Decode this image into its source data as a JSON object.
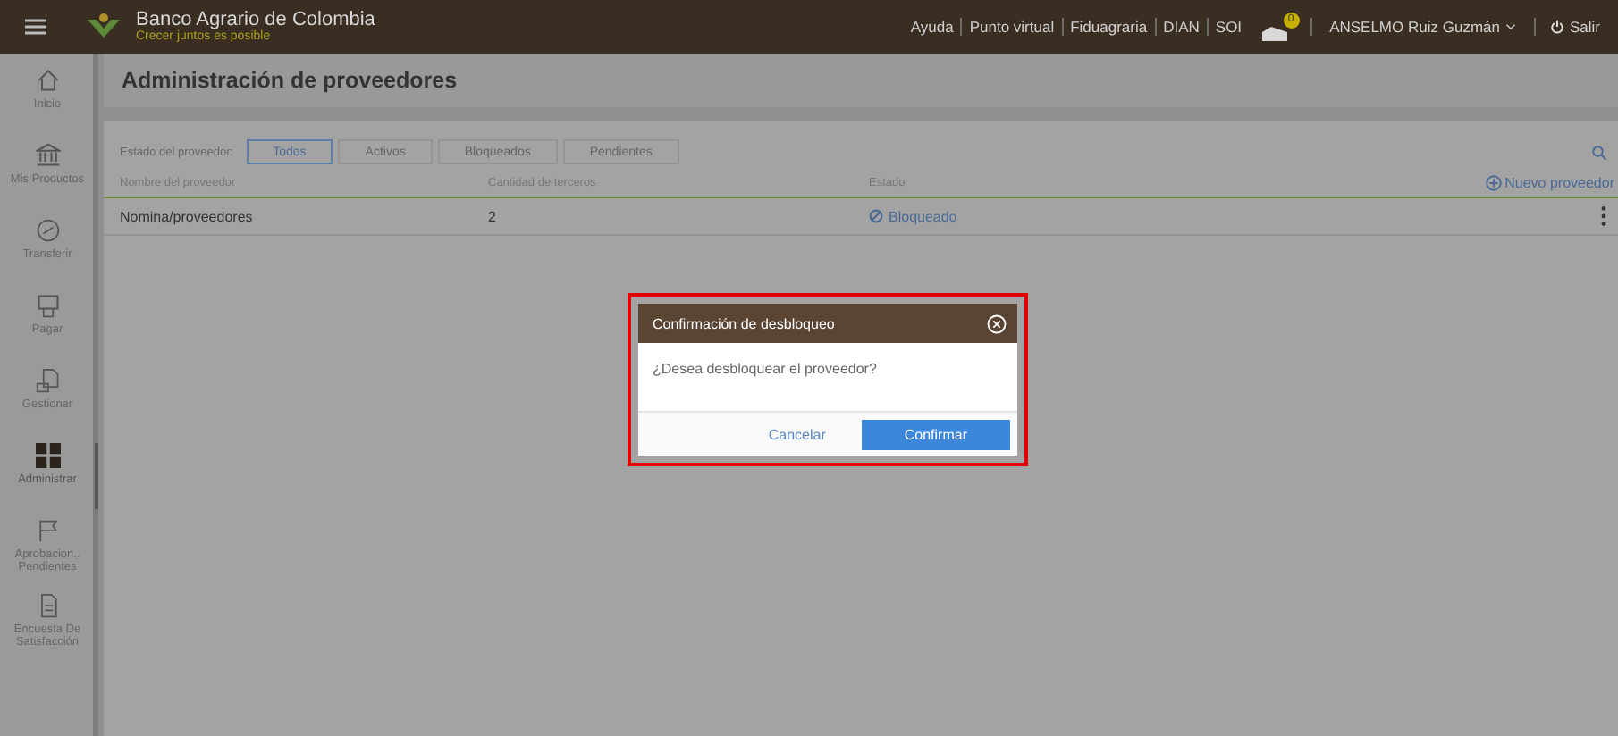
{
  "header": {
    "brand": "Banco Agrario de Colombia",
    "tagline": "Crecer juntos es posible",
    "links": [
      "Ayuda",
      "Punto virtual",
      "Fiduagraria",
      "DIAN",
      "SOI"
    ],
    "notification_count": "0",
    "user": "ANSELMO Ruiz Guzmán",
    "logout": "Salir"
  },
  "sidebar": {
    "items": [
      {
        "label": "Inicio",
        "kind": "home",
        "selected": false
      },
      {
        "label": "Mis Productos",
        "kind": "bank",
        "selected": false
      },
      {
        "label": "Transferir",
        "kind": "transfer",
        "selected": false
      },
      {
        "label": "Pagar",
        "kind": "pay",
        "selected": false
      },
      {
        "label": "Gestionar",
        "kind": "manage",
        "selected": false
      },
      {
        "label": "Administrar",
        "kind": "grid",
        "selected": true
      },
      {
        "label": "Aprobacion.. Pendientes",
        "kind": "flag",
        "selected": false
      },
      {
        "label": "Encuesta De Satisfacción",
        "kind": "survey",
        "selected": false
      }
    ]
  },
  "page_title": "Administración de proveedores",
  "filter": {
    "label": "Estado del proveedor:",
    "tabs": [
      {
        "label": "Todos",
        "selected": true
      },
      {
        "label": "Activos",
        "selected": false
      },
      {
        "label": "Bloqueados",
        "selected": false
      },
      {
        "label": "Pendientes",
        "selected": false
      }
    ]
  },
  "new_button": "Nuevo proveedor",
  "table": {
    "columns": [
      "Nombre del proveedor",
      "Cantidad de terceros",
      "Estado"
    ],
    "rows": [
      {
        "name": "Nomina/proveedores",
        "count": "2",
        "status": "Bloqueado"
      }
    ]
  },
  "dialog": {
    "title": "Confirmación de desbloqueo",
    "message": "¿Desea desbloquear el proveedor?",
    "cancel": "Cancelar",
    "confirm": "Confirmar"
  }
}
